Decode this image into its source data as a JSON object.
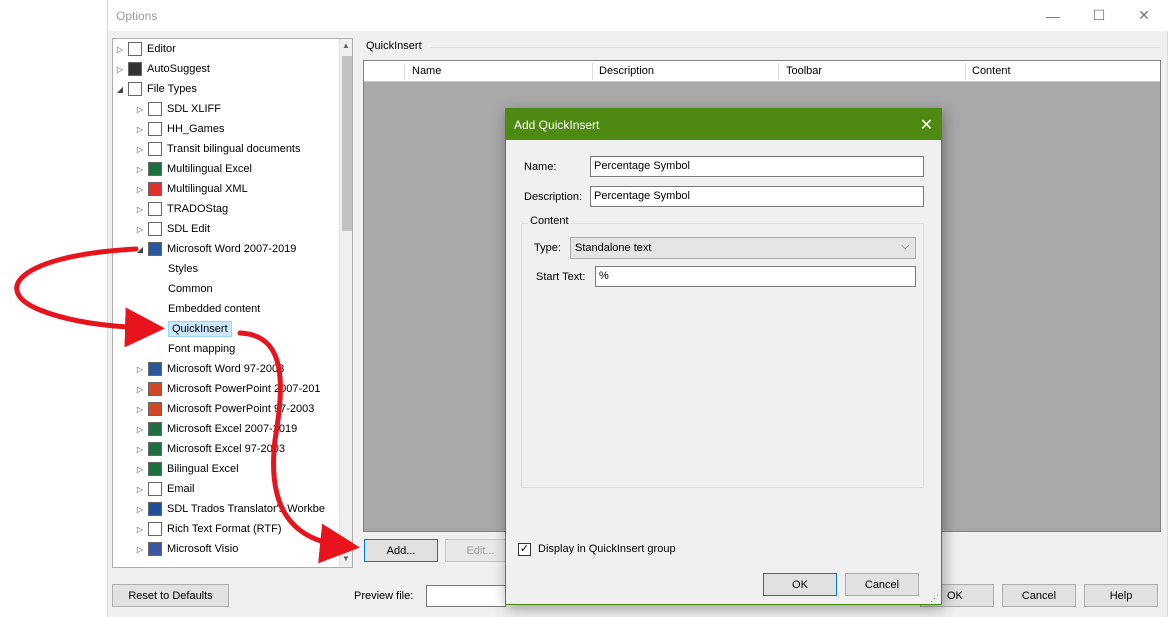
{
  "window": {
    "title": "Options"
  },
  "window_controls": {
    "minimize": "—",
    "maximize": "☐",
    "close": "✕"
  },
  "tree": {
    "items": [
      {
        "label": "Editor",
        "level": 0,
        "expander": "▷",
        "icon": "pen-icon",
        "icon_color": "#ffffff"
      },
      {
        "label": "AutoSuggest",
        "level": 0,
        "expander": "▷",
        "icon": "autosuggest-icon",
        "icon_color": "#333333"
      },
      {
        "label": "File Types",
        "level": 0,
        "expander": "◢",
        "icon": "gear-icon",
        "icon_color": "#ffffff"
      },
      {
        "label": "SDL XLIFF",
        "level": 1,
        "expander": "▷",
        "icon": "document-icon",
        "icon_color": "#ffffff"
      },
      {
        "label": "HH_Games",
        "level": 1,
        "expander": "▷",
        "icon": "document-icon",
        "icon_color": "#ffffff"
      },
      {
        "label": "Transit bilingual documents",
        "level": 1,
        "expander": "▷",
        "icon": "transit-icon",
        "icon_color": "#ffffff"
      },
      {
        "label": "Multilingual Excel",
        "level": 1,
        "expander": "▷",
        "icon": "excel-icon",
        "icon_color": "#1d6f42"
      },
      {
        "label": "Multilingual XML",
        "level": 1,
        "expander": "▷",
        "icon": "xml-icon",
        "icon_color": "#e03030"
      },
      {
        "label": "TRADOStag",
        "level": 1,
        "expander": "▷",
        "icon": "tradostag-icon",
        "icon_color": "#ffffff"
      },
      {
        "label": "SDL Edit",
        "level": 1,
        "expander": "▷",
        "icon": "edit-icon",
        "icon_color": "#ffffff"
      },
      {
        "label": "Microsoft Word 2007-2019",
        "level": 1,
        "expander": "◢",
        "icon": "word-icon",
        "icon_color": "#2b579a"
      },
      {
        "label": "Styles",
        "level": 2,
        "expander": "",
        "icon": "",
        "icon_color": ""
      },
      {
        "label": "Common",
        "level": 2,
        "expander": "",
        "icon": "",
        "icon_color": ""
      },
      {
        "label": "Embedded content",
        "level": 2,
        "expander": "",
        "icon": "",
        "icon_color": ""
      },
      {
        "label": "QuickInsert",
        "level": 2,
        "expander": "",
        "icon": "",
        "icon_color": "",
        "selected": true
      },
      {
        "label": "Font mapping",
        "level": 2,
        "expander": "",
        "icon": "",
        "icon_color": ""
      },
      {
        "label": "Microsoft Word 97-2003",
        "level": 1,
        "expander": "▷",
        "icon": "word-icon",
        "icon_color": "#2b579a"
      },
      {
        "label": "Microsoft PowerPoint 2007-201",
        "level": 1,
        "expander": "▷",
        "icon": "powerpoint-icon",
        "icon_color": "#d24726"
      },
      {
        "label": "Microsoft PowerPoint 97-2003",
        "level": 1,
        "expander": "▷",
        "icon": "powerpoint-icon",
        "icon_color": "#d24726"
      },
      {
        "label": "Microsoft Excel 2007-2019",
        "level": 1,
        "expander": "▷",
        "icon": "excel-icon",
        "icon_color": "#1d6f42"
      },
      {
        "label": "Microsoft Excel 97-2003",
        "level": 1,
        "expander": "▷",
        "icon": "excel-icon",
        "icon_color": "#1d6f42"
      },
      {
        "label": "Bilingual Excel",
        "level": 1,
        "expander": "▷",
        "icon": "excel-icon",
        "icon_color": "#1d6f42"
      },
      {
        "label": "Email",
        "level": 1,
        "expander": "▷",
        "icon": "email-icon",
        "icon_color": "#ffffff"
      },
      {
        "label": "SDL Trados Translator's Workbe",
        "level": 1,
        "expander": "▷",
        "icon": "trados-icon",
        "icon_color": "#1f4e9c"
      },
      {
        "label": "Rich Text Format (RTF)",
        "level": 1,
        "expander": "▷",
        "icon": "rtf-icon",
        "icon_color": "#ffffff"
      },
      {
        "label": "Microsoft Visio",
        "level": 1,
        "expander": "▷",
        "icon": "visio-icon",
        "icon_color": "#3955a3"
      }
    ]
  },
  "quickinsert": {
    "group_label": "QuickInsert",
    "columns": [
      "Name",
      "Description",
      "Toolbar",
      "Content"
    ],
    "add_button": "Add...",
    "edit_button": "Edit..."
  },
  "bottom": {
    "reset_button": "Reset to Defaults",
    "preview_label": "Preview file:",
    "ok_button": "OK",
    "cancel_button": "Cancel",
    "help_button": "Help"
  },
  "dialog": {
    "title": "Add QuickInsert",
    "close_glyph": "✕",
    "name_label": "Name:",
    "name_value": "Percentage Symbol",
    "description_label": "Description:",
    "description_value": "Percentage Symbol",
    "content_label": "Content",
    "type_label": "Type:",
    "type_value": "Standalone text",
    "start_text_label": "Start Text:",
    "start_text_value": "%",
    "checkbox_checked": true,
    "checkbox_label": "Display in QuickInsert group",
    "ok_button": "OK",
    "cancel_button": "Cancel"
  },
  "colors": {
    "dialog_title_bg": "#4e8a12",
    "accent_blue": "#0078d7",
    "arrow_red": "#e8141d",
    "table_bg": "#a9a9a9"
  }
}
